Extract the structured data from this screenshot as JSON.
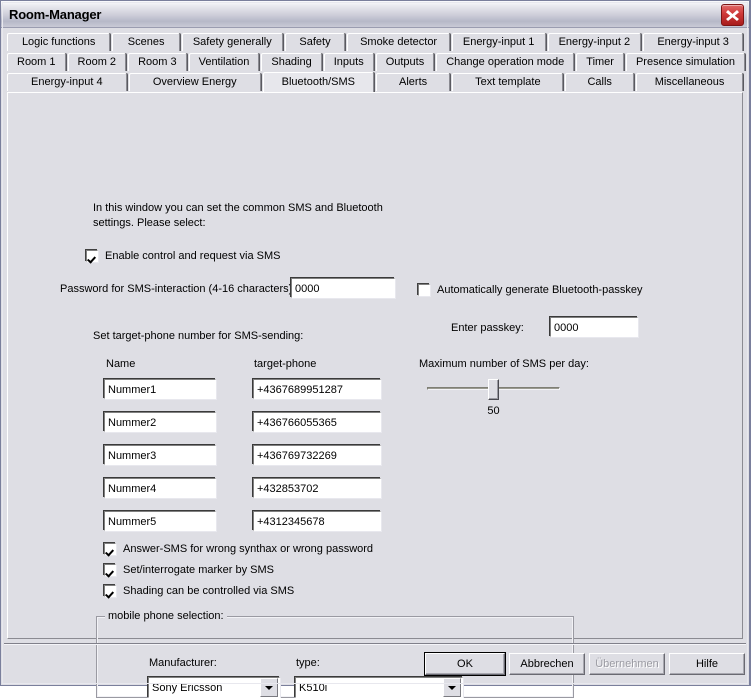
{
  "window": {
    "title": "Room-Manager",
    "close_icon": "close-icon"
  },
  "tabs": {
    "row1": [
      {
        "label": "Logic functions",
        "active": false
      },
      {
        "label": "Scenes",
        "active": false
      },
      {
        "label": "Safety generally",
        "active": false
      },
      {
        "label": "Safety",
        "active": false
      },
      {
        "label": "Smoke detector",
        "active": false
      },
      {
        "label": "Energy-input 1",
        "active": false
      },
      {
        "label": "Energy-input 2",
        "active": false
      },
      {
        "label": "Energy-input 3",
        "active": false
      }
    ],
    "row2": [
      {
        "label": "Room 1",
        "active": false
      },
      {
        "label": "Room 2",
        "active": false
      },
      {
        "label": "Room 3",
        "active": false
      },
      {
        "label": "Ventilation",
        "active": false
      },
      {
        "label": "Shading",
        "active": false
      },
      {
        "label": "Inputs",
        "active": false
      },
      {
        "label": "Outputs",
        "active": false
      },
      {
        "label": "Change operation mode",
        "active": false
      },
      {
        "label": "Timer",
        "active": false
      },
      {
        "label": "Presence simulation",
        "active": false
      }
    ],
    "row3": [
      {
        "label": "Energy-input 4",
        "active": false
      },
      {
        "label": "Overview Energy",
        "active": false
      },
      {
        "label": "Bluetooth/SMS",
        "active": true
      },
      {
        "label": "Alerts",
        "active": false
      },
      {
        "label": "Text template",
        "active": false
      },
      {
        "label": "Calls",
        "active": false
      },
      {
        "label": "Miscellaneous",
        "active": false
      }
    ]
  },
  "content": {
    "intro": "In this window you can set the common SMS and Bluetooth settings. Please select:",
    "enable_sms": {
      "label": "Enable control and request via SMS",
      "checked": true
    },
    "password_label": "Password for SMS-interaction (4-16 characters):",
    "password_value": "0000",
    "auto_passkey": {
      "label": "Automatically generate Bluetooth-passkey",
      "checked": false
    },
    "passkey_label": "Enter passkey:",
    "passkey_value": "0000",
    "target_phone_heading": "Set target-phone number for SMS-sending:",
    "col_name": "Name",
    "col_phone": "target-phone",
    "rows": [
      {
        "name": "Nummer1",
        "phone": "+4367689951287"
      },
      {
        "name": "Nummer2",
        "phone": "+436766055365"
      },
      {
        "name": "Nummer3",
        "phone": "+436769732269"
      },
      {
        "name": "Nummer4",
        "phone": "+432853702"
      },
      {
        "name": "Nummer5",
        "phone": "+4312345678"
      }
    ],
    "slider_label": "Maximum number of SMS per day:",
    "slider_value": "50",
    "options": [
      {
        "label": "Answer-SMS for wrong synthax or wrong password",
        "checked": true
      },
      {
        "label": "Set/interrogate marker by SMS",
        "checked": true
      },
      {
        "label": "Shading can be controlled via SMS",
        "checked": true
      }
    ],
    "phone_group": {
      "title": "mobile phone selection:",
      "manufacturer_label": "Manufacturer:",
      "manufacturer_value": "Sony Ericsson",
      "type_label": "type:",
      "type_value": "K510i"
    }
  },
  "buttons": {
    "ok": "OK",
    "cancel": "Abbrechen",
    "apply": "Übernehmen",
    "help": "Hilfe"
  }
}
